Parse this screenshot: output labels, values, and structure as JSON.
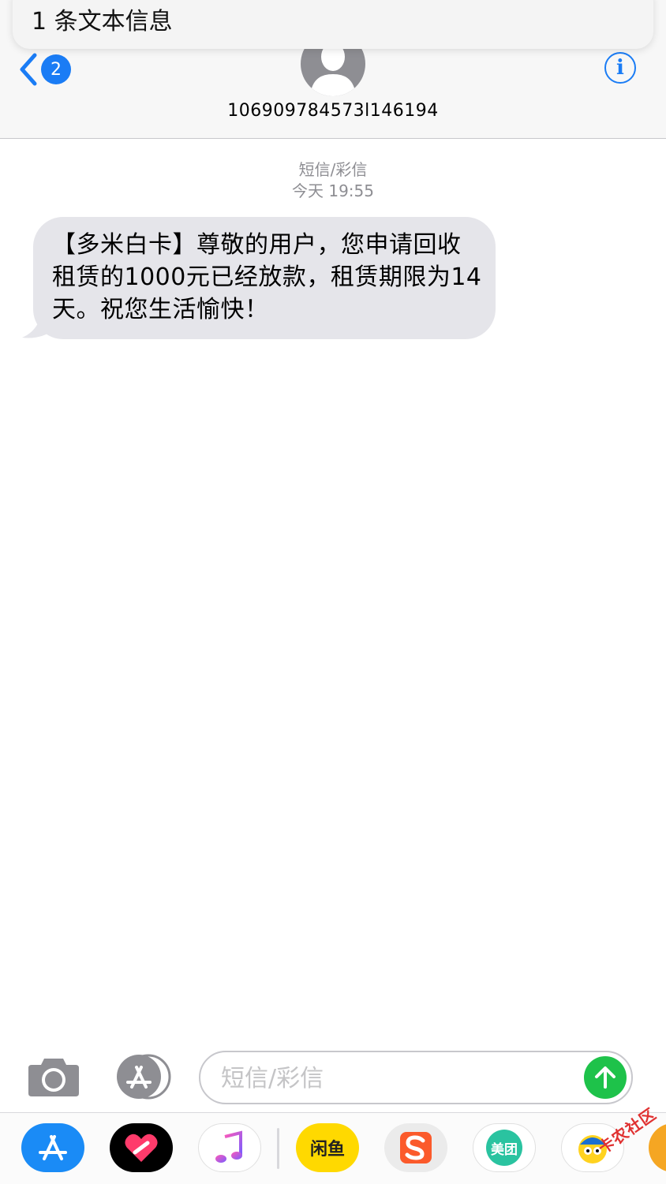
{
  "notification": {
    "text": "1 条文本信息"
  },
  "header": {
    "back_badge": "2",
    "contact": "106909784573l146194",
    "info_glyph": "i"
  },
  "conversation": {
    "service": "短信/彩信",
    "timestamp": "今天 19:55",
    "messages": [
      {
        "direction": "incoming",
        "text": "【多米白卡】尊敬的用户，您申请回收租赁的1000元已经放款，租赁期限为14天。祝您生活愉快！"
      }
    ]
  },
  "composer": {
    "placeholder": "短信/彩信",
    "value": ""
  },
  "app_drawer": {
    "xianyu_label": "闲鱼",
    "meituan_label": "美团",
    "watermark": "卡农社区"
  },
  "colors": {
    "accent": "#1a7cf5",
    "send": "#1ec24a",
    "bubble": "#e5e5ea"
  }
}
